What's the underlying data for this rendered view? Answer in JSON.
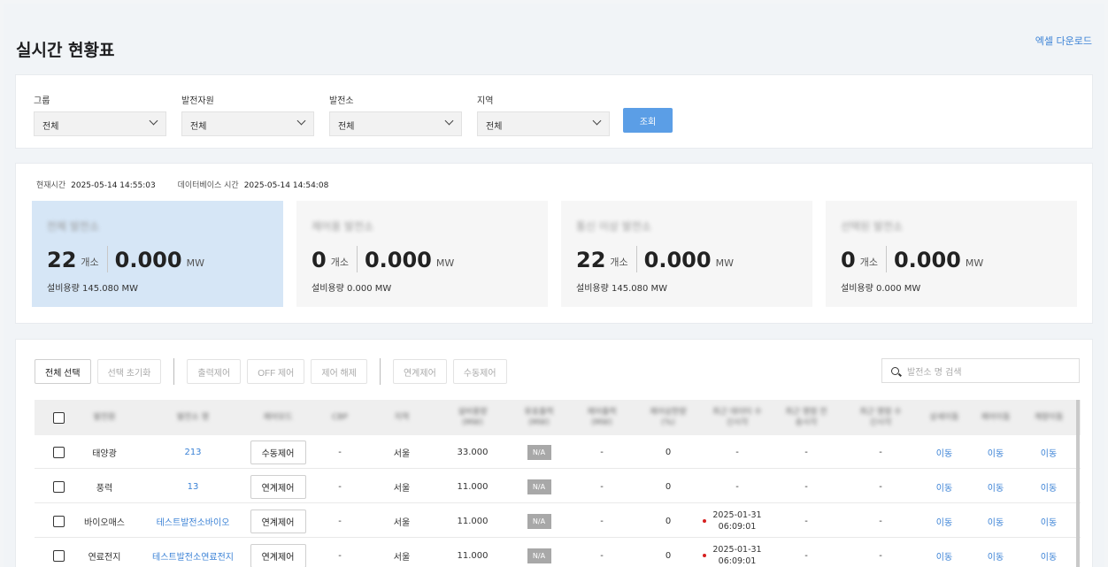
{
  "page": {
    "title": "실시간 현황표",
    "excel_download": "엑셀 다운로드"
  },
  "filters": [
    {
      "label": "그룹",
      "value": "전체"
    },
    {
      "label": "발전자원",
      "value": "전체"
    },
    {
      "label": "발전소",
      "value": "전체"
    },
    {
      "label": "지역",
      "value": "전체"
    }
  ],
  "query_button": "조회",
  "times": {
    "current_label": "현재시간",
    "current_value": "2025-05-14 14:55:03",
    "db_label": "데이터베이스 시간",
    "db_value": "2025-05-14 14:54:08"
  },
  "cards": [
    {
      "title": "전체 발전소",
      "count": "22",
      "count_unit": "개소",
      "mw": "0.000",
      "mw_unit": "MW",
      "capacity": "설비용량 145.080 MW",
      "active": true
    },
    {
      "title": "제어용 발전소",
      "count": "0",
      "count_unit": "개소",
      "mw": "0.000",
      "mw_unit": "MW",
      "capacity": "설비용량 0.000 MW",
      "active": false
    },
    {
      "title": "통신 이상 발전소",
      "count": "22",
      "count_unit": "개소",
      "mw": "0.000",
      "mw_unit": "MW",
      "capacity": "설비용량 145.080 MW",
      "active": false
    },
    {
      "title": "선택된 발전소",
      "count": "0",
      "count_unit": "개소",
      "mw": "0.000",
      "mw_unit": "MW",
      "capacity": "설비용량 0.000 MW",
      "active": false
    }
  ],
  "toolbar": {
    "select_all": "전체 선택",
    "reset_selection": "선택 초기화",
    "output_control": "출력제어",
    "off_control": "OFF 제어",
    "release_control": "제어 해제",
    "linked_control": "연계제어",
    "manual_control": "수동제어"
  },
  "search": {
    "placeholder": "발전소 명 검색"
  },
  "table": {
    "headers": [
      "발전원",
      "발전소 명",
      "제어모드",
      "CBP",
      "지역",
      "설비용량 (MW)",
      "유효출력 (MW)",
      "제어출력 (MW)",
      "제어상한량 (%)",
      "최근 데이터 수신시각",
      "최근 명령 전송시각",
      "최근 명령 수신시각",
      "상세이동",
      "제어이동",
      "계량이동"
    ],
    "rows": [
      {
        "source": "태양광",
        "name": "213",
        "mode": "수동제어",
        "cbp": "-",
        "region": "서울",
        "capacity": "33.000",
        "active_power": "N/A",
        "control_power": "-",
        "limit": "0",
        "last_data": "-",
        "last_data2": "",
        "cmd_sent": "-",
        "cmd_recv": "-",
        "move1": "이동",
        "move2": "이동",
        "move3": "이동",
        "alert": false
      },
      {
        "source": "풍력",
        "name": "13",
        "mode": "연계제어",
        "cbp": "-",
        "region": "서울",
        "capacity": "11.000",
        "active_power": "N/A",
        "control_power": "-",
        "limit": "0",
        "last_data": "-",
        "last_data2": "",
        "cmd_sent": "-",
        "cmd_recv": "-",
        "move1": "이동",
        "move2": "이동",
        "move3": "이동",
        "alert": false
      },
      {
        "source": "바이오매스",
        "name": "테스트발전소바이오",
        "mode": "연계제어",
        "cbp": "-",
        "region": "서울",
        "capacity": "11.000",
        "active_power": "N/A",
        "control_power": "-",
        "limit": "0",
        "last_data": "2025-01-31",
        "last_data2": "06:09:01",
        "cmd_sent": "-",
        "cmd_recv": "-",
        "move1": "이동",
        "move2": "이동",
        "move3": "이동",
        "alert": true
      },
      {
        "source": "연료전지",
        "name": "테스트발전소연료전지",
        "mode": "연계제어",
        "cbp": "-",
        "region": "서울",
        "capacity": "11.000",
        "active_power": "N/A",
        "control_power": "-",
        "limit": "0",
        "last_data": "2025-01-31",
        "last_data2": "06:09:01",
        "cmd_sent": "-",
        "cmd_recv": "-",
        "move1": "이동",
        "move2": "이동",
        "move3": "이동",
        "alert": true
      }
    ]
  },
  "colors": {
    "accent": "#5b9ee6",
    "link": "#3b82d6",
    "active_card": "#d6e6f6",
    "alert_dot": "#d62020"
  }
}
